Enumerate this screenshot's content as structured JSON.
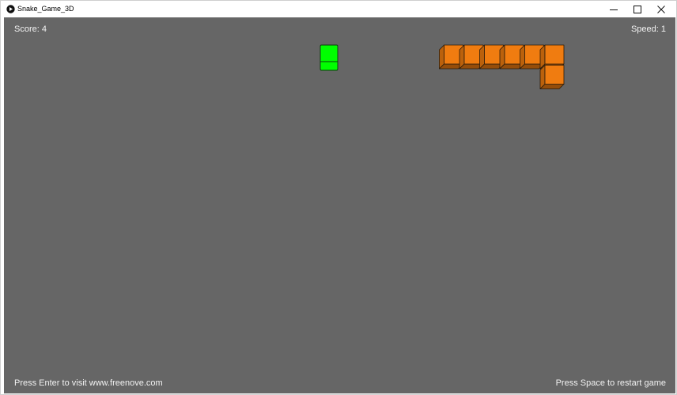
{
  "window": {
    "title": "Snake_Game_3D",
    "minimize_glyph": "minimize-icon",
    "maximize_glyph": "maximize-icon",
    "close_glyph": "close-icon"
  },
  "hud": {
    "score_text": "Score: 4",
    "speed_text": "Speed: 1",
    "enter_hint": "Press Enter to visit www.freenove.com",
    "space_hint": "Press Space to restart game"
  },
  "game": {
    "food": {
      "col": 0,
      "row": 0,
      "color": "#00ff00"
    },
    "snake_color": "#f07c10",
    "snake_segments": [
      {
        "col": 6,
        "row": 1
      },
      {
        "col": 6,
        "row": 0
      },
      {
        "col": 5,
        "row": 0
      },
      {
        "col": 4,
        "row": 0
      },
      {
        "col": 3,
        "row": 0
      },
      {
        "col": 2,
        "row": 0
      },
      {
        "col": 1,
        "row": 0
      }
    ],
    "background_color": "#666666"
  }
}
